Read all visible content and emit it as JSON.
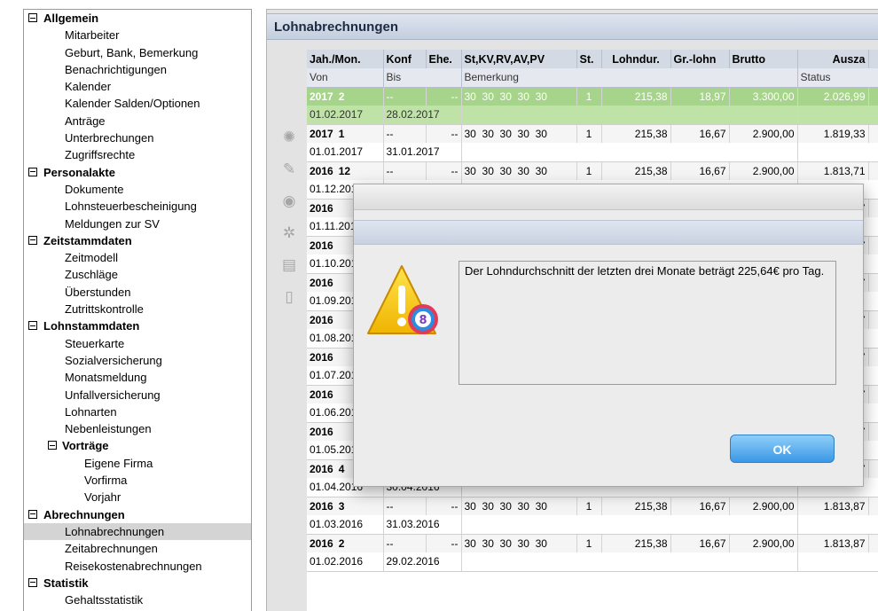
{
  "tree": {
    "groups": [
      {
        "label": "Allgemein",
        "items": [
          "Mitarbeiter",
          "Geburt, Bank, Bemerkung",
          "Benachrichtigungen",
          "Kalender",
          "Kalender Salden/Optionen",
          "Anträge",
          "Unterbrechungen",
          "Zugriffsrechte"
        ]
      },
      {
        "label": "Personalakte",
        "items": [
          "Dokumente",
          "Lohnsteuerbescheinigung",
          "Meldungen zur SV"
        ]
      },
      {
        "label": "Zeitstammdaten",
        "items": [
          "Zeitmodell",
          "Zuschläge",
          "Überstunden",
          "Zutrittskontrolle"
        ]
      },
      {
        "label": "Lohnstammdaten",
        "items": [
          "Steuerkarte",
          "Sozialversicherung",
          "Monatsmeldung",
          "Unfallversicherung",
          "Lohnarten",
          "Nebenleistungen"
        ],
        "sub": {
          "label": "Vorträge",
          "items": [
            "Eigene Firma",
            "Vorfirma",
            "Vorjahr"
          ]
        }
      },
      {
        "label": "Abrechnungen",
        "items": [
          "Lohnabrechnungen",
          "Zeitabrechnungen",
          "Reisekostenabrechnungen"
        ],
        "selected": "Lohnabrechnungen"
      },
      {
        "label": "Statistik",
        "items": [
          "Gehaltsstatistik"
        ]
      }
    ]
  },
  "panel": {
    "title": "Lohnabrechnungen",
    "columns": [
      "Jah./Mon.",
      "Konf",
      "Ehe.",
      "St,KV,RV,AV,PV",
      "St.",
      "Lohndur.",
      "Gr.-lohn",
      "Brutto",
      "Ausza"
    ],
    "subcolumns": {
      "von": "Von",
      "bis": "Bis",
      "bemerkung": "Bemerkung",
      "status": "Status"
    },
    "rows": [
      {
        "jahr": "2017",
        "mon": "2",
        "konf": "--",
        "ehe": "--",
        "sv": "30  30  30  30  30",
        "st": "1",
        "lohndur": "215,38",
        "grlohn": "18,97",
        "brutto": "3.300,00",
        "ausz": "2.026,99",
        "von": "01.02.2017",
        "bis": "28.02.2017",
        "highlight": true
      },
      {
        "jahr": "2017",
        "mon": "1",
        "konf": "--",
        "ehe": "--",
        "sv": "30  30  30  30  30",
        "st": "1",
        "lohndur": "215,38",
        "grlohn": "16,67",
        "brutto": "2.900,00",
        "ausz": "1.819,33",
        "von": "01.01.2017",
        "bis": "31.01.2017"
      },
      {
        "jahr": "2016",
        "mon": "12",
        "konf": "--",
        "ehe": "--",
        "sv": "30  30  30  30  30",
        "st": "1",
        "lohndur": "215,38",
        "grlohn": "16,67",
        "brutto": "2.900,00",
        "ausz": "1.813,71",
        "von": "01.12.2016",
        "bis": ""
      },
      {
        "jahr": "2016",
        "mon": "",
        "konf": "",
        "ehe": "",
        "sv": "",
        "st": "",
        "lohndur": "",
        "grlohn": "",
        "brutto": "",
        "ausz": "1.813,87",
        "von": "01.11.2016",
        "bis": ""
      },
      {
        "jahr": "2016",
        "mon": "",
        "konf": "",
        "ehe": "",
        "sv": "",
        "st": "",
        "lohndur": "",
        "grlohn": "",
        "brutto": "",
        "ausz": "1.813,87",
        "von": "01.10.2016",
        "bis": ""
      },
      {
        "jahr": "2016",
        "mon": "",
        "konf": "",
        "ehe": "",
        "sv": "",
        "st": "",
        "lohndur": "",
        "grlohn": "",
        "brutto": "",
        "ausz": "1.813,87",
        "von": "01.09.2016",
        "bis": ""
      },
      {
        "jahr": "2016",
        "mon": "",
        "konf": "",
        "ehe": "",
        "sv": "",
        "st": "",
        "lohndur": "",
        "grlohn": "",
        "brutto": "",
        "ausz": "1.813,87",
        "von": "01.08.2016",
        "bis": ""
      },
      {
        "jahr": "2016",
        "mon": "",
        "konf": "",
        "ehe": "",
        "sv": "",
        "st": "",
        "lohndur": "",
        "grlohn": "",
        "brutto": "",
        "ausz": "1.813,87",
        "von": "01.07.2016",
        "bis": ""
      },
      {
        "jahr": "2016",
        "mon": "",
        "konf": "",
        "ehe": "",
        "sv": "",
        "st": "",
        "lohndur": "",
        "grlohn": "",
        "brutto": "",
        "ausz": "1.813,87",
        "von": "01.06.2016",
        "bis": ""
      },
      {
        "jahr": "2016",
        "mon": "",
        "konf": "",
        "ehe": "",
        "sv": "",
        "st": "",
        "lohndur": "",
        "grlohn": "",
        "brutto": "",
        "ausz": "1.813,87",
        "von": "01.05.2016",
        "bis": ""
      },
      {
        "jahr": "2016",
        "mon": "4",
        "konf": "--",
        "ehe": "--",
        "sv": "30  30  30  30  30",
        "st": "1",
        "lohndur": "215,38",
        "grlohn": "16,67",
        "brutto": "2.900,00",
        "ausz": "1.813,87",
        "von": "01.04.2016",
        "bis": "30.04.2016"
      },
      {
        "jahr": "2016",
        "mon": "3",
        "konf": "--",
        "ehe": "--",
        "sv": "30  30  30  30  30",
        "st": "1",
        "lohndur": "215,38",
        "grlohn": "16,67",
        "brutto": "2.900,00",
        "ausz": "1.813,87",
        "von": "01.03.2016",
        "bis": "31.03.2016"
      },
      {
        "jahr": "2016",
        "mon": "2",
        "konf": "--",
        "ehe": "--",
        "sv": "30  30  30  30  30",
        "st": "1",
        "lohndur": "215,38",
        "grlohn": "16,67",
        "brutto": "2.900,00",
        "ausz": "1.813,87",
        "von": "01.02.2016",
        "bis": "29.02.2016"
      }
    ]
  },
  "dialog": {
    "message": "Der Lohndurchschnitt der letzten drei Monate beträgt 225,64€ pro Tag.",
    "ok_label": "OK",
    "icon": "warning-icon"
  },
  "toolbar": {
    "icons": [
      "gear-icon",
      "edit-icon",
      "eye-icon",
      "settings-icon",
      "print-icon",
      "trash-icon"
    ]
  },
  "colors": {
    "highlight_row": "#a7d48b",
    "ok_button": "#3b97e6",
    "panel_title_bg": "#c3cede"
  }
}
